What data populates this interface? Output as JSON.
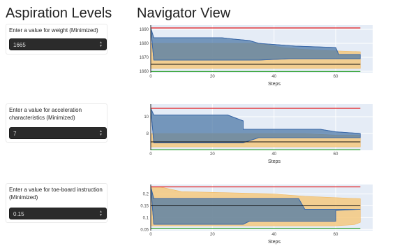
{
  "aspiration": {
    "title": "Aspiration Levels",
    "items": [
      {
        "label": "Enter a value for weight (Minimized)",
        "value": "1665"
      },
      {
        "label": "Enter a value for acceleration characteristics (Minimized)",
        "value": "7"
      },
      {
        "label": "Enter a value for toe-board instruction (Minimized)",
        "value": "0.15"
      }
    ]
  },
  "navigator": {
    "title": "Navigator View",
    "x_title": "Steps",
    "colors": {
      "plot_bg": "#e5ecf6",
      "orange_band": "#f5c97f",
      "blue_band": "#4e79a7",
      "upper_line": "#e41a1c",
      "lower_line": "#2ca02c",
      "ref_line": "#111111"
    }
  },
  "chart_data": [
    {
      "type": "area",
      "xlabel": "Steps",
      "xlim": [
        0,
        68
      ],
      "ylim": [
        1659,
        1693
      ],
      "x_ticks": [
        0,
        20,
        40,
        60
      ],
      "y_ticks": [
        1660,
        1670,
        1680,
        1690
      ],
      "upper_bound": 1691,
      "lower_bound": 1659.8,
      "reference": 1665,
      "orange_upper": [
        [
          0,
          1691
        ],
        [
          0,
          1680
        ],
        [
          34,
          1680
        ],
        [
          38,
          1679
        ],
        [
          40,
          1678
        ],
        [
          43,
          1677
        ],
        [
          48,
          1676
        ],
        [
          55,
          1675
        ],
        [
          68,
          1674
        ],
        [
          68,
          1662
        ],
        [
          0,
          1662
        ]
      ],
      "orange_lower": [
        [
          0,
          1662
        ],
        [
          68,
          1662
        ]
      ],
      "blue_upper": [
        [
          0,
          1691
        ],
        [
          1,
          1684
        ],
        [
          23,
          1684
        ],
        [
          27,
          1683
        ],
        [
          32,
          1682
        ],
        [
          35,
          1680
        ],
        [
          47,
          1678
        ],
        [
          60,
          1677
        ],
        [
          61,
          1672
        ],
        [
          68,
          1672
        ]
      ],
      "blue_lower": [
        [
          0,
          1691
        ],
        [
          1,
          1668
        ],
        [
          35,
          1668
        ],
        [
          45,
          1669
        ],
        [
          68,
          1669
        ]
      ]
    },
    {
      "type": "area",
      "xlabel": "Steps",
      "xlim": [
        0,
        68
      ],
      "ylim": [
        6,
        11.5
      ],
      "x_ticks": [
        0,
        20,
        40,
        60
      ],
      "y_ticks": [
        8,
        10
      ],
      "upper_bound": 11,
      "lower_bound": 6.05,
      "reference": 7,
      "orange_upper": [
        [
          0,
          11
        ],
        [
          0,
          8
        ],
        [
          50,
          8
        ],
        [
          60,
          7.8
        ],
        [
          68,
          7.8
        ],
        [
          68,
          6.4
        ],
        [
          0,
          6.4
        ]
      ],
      "orange_lower": [
        [
          0,
          6.4
        ],
        [
          68,
          6.4
        ]
      ],
      "blue_upper": [
        [
          0,
          11
        ],
        [
          1,
          10.2
        ],
        [
          25,
          10.2
        ],
        [
          30,
          9.5
        ],
        [
          30,
          8.5
        ],
        [
          55,
          8.5
        ],
        [
          60,
          8.2
        ],
        [
          68,
          8
        ]
      ],
      "blue_lower": [
        [
          0,
          11
        ],
        [
          1,
          6.9
        ],
        [
          30,
          6.9
        ],
        [
          35,
          7.5
        ],
        [
          68,
          7.5
        ]
      ]
    },
    {
      "type": "area",
      "xlabel": "Steps",
      "xlim": [
        0,
        68
      ],
      "ylim": [
        0.045,
        0.24
      ],
      "x_ticks": [
        0,
        20,
        40,
        60
      ],
      "y_ticks": [
        0.05,
        0.1,
        0.15,
        0.2
      ],
      "upper_bound": 0.23,
      "lower_bound": 0.055,
      "reference": 0.15,
      "orange_upper": [
        [
          0,
          0.23
        ],
        [
          3,
          0.23
        ],
        [
          10,
          0.21
        ],
        [
          40,
          0.2
        ],
        [
          50,
          0.19
        ],
        [
          68,
          0.18
        ],
        [
          68,
          0.08
        ],
        [
          66,
          0.07
        ],
        [
          60,
          0.065
        ],
        [
          0,
          0.065
        ]
      ],
      "orange_lower": [
        [
          0,
          0.065
        ],
        [
          60,
          0.065
        ]
      ],
      "blue_upper": [
        [
          0,
          0.23
        ],
        [
          1,
          0.18
        ],
        [
          48,
          0.18
        ],
        [
          50,
          0.135
        ],
        [
          68,
          0.135
        ]
      ],
      "blue_lower": [
        [
          0,
          0.23
        ],
        [
          1,
          0.072
        ],
        [
          30,
          0.072
        ],
        [
          32,
          0.085
        ],
        [
          60,
          0.085
        ],
        [
          60,
          0.13
        ]
      ]
    }
  ]
}
